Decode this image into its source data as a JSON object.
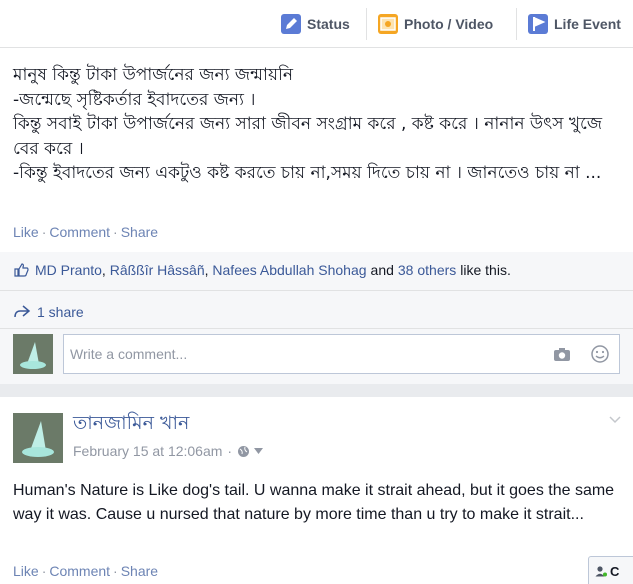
{
  "composer": {
    "tabs": [
      {
        "label": "Status",
        "icon": "pencil-icon"
      },
      {
        "label": "Photo / Video",
        "icon": "photo-icon"
      },
      {
        "label": "Life Event",
        "icon": "flag-icon"
      }
    ]
  },
  "post1": {
    "text": "মানুষ কিন্তু টাকা উপার্জনের জন্য জন্মায়নি\n-জন্মেছে সৃষ্টিকর্তার ইবাদতের জন্য ।\nকিন্তু সবাই টাকা উপার্জনের জন্য সারা জীবন সংগ্রাম করে , কষ্ট করে । নানান উৎস খুজে বের করে ।\n-কিন্তু ইবাদতের জন্য একটুও কষ্ট করতে চায় না,সময় দিতে চায় না । জানতেও চায় না ...",
    "actions": {
      "like": "Like",
      "comment": "Comment",
      "share": "Share"
    },
    "likes": {
      "names": [
        "MD Pranto",
        "Râßßîr Hâssâñ",
        "Nafees Abdullah Shohag"
      ],
      "and": "and",
      "others": "38 others",
      "suffix": "like this."
    },
    "shares": "1 share",
    "comment_placeholder": "Write a comment..."
  },
  "post2": {
    "author": "তানজামিন খান",
    "timestamp": "February 15 at 12:06am",
    "separator": "·",
    "text": "Human's Nature is Like dog's tail. U wanna make it strait ahead, but it goes the same way it was. Cause u nursed that nature by more time than u try to make it strait...",
    "actions": {
      "like": "Like",
      "comment": "Comment",
      "share": "Share"
    }
  },
  "chat": {
    "label": "C"
  },
  "colors": {
    "link": "#3b5998",
    "muted": "#9197a3",
    "action": "#6d84b4",
    "accent_status": "#4a76c6",
    "accent_photo": "#f5a623"
  }
}
